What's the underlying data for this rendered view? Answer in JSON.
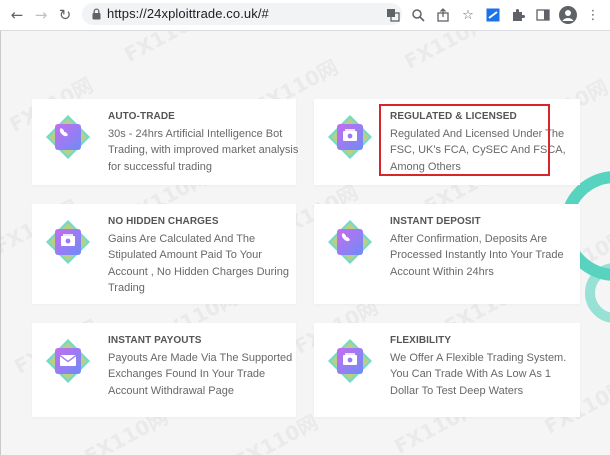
{
  "browser": {
    "url": "https://24xploittrade.co.uk/#"
  },
  "features": [
    {
      "title": "AUTO-TRADE",
      "description": "30s - 24hrs Artificial Intelligence Bot Trading, with improved market analysis for successful trading",
      "icon": "phone-icon"
    },
    {
      "title": "REGULATED & LICENSED",
      "description": "Regulated And Licensed Under The FSC, UK's FCA, CySEC And FSCA, Among Others",
      "icon": "money-icon"
    },
    {
      "title": "NO HIDDEN CHARGES",
      "description": "Gains Are Calculated And The Stipulated Amount Paid To Your Account , No Hidden Charges During Trading",
      "icon": "money-icon"
    },
    {
      "title": "INSTANT DEPOSIT",
      "description": "After Confirmation, Deposits Are Processed Instantly Into Your Trade Account Within 24hrs",
      "icon": "phone-icon"
    },
    {
      "title": "INSTANT PAYOUTS",
      "description": "Payouts Are Made Via The Supported Exchanges Found In Your Trade Account Withdrawal Page",
      "icon": "envelope-icon"
    },
    {
      "title": "FLEXIBILITY",
      "description": "We Offer A Flexible Trading System. You Can Trade With As Low As 1 Dollar To Test Deep Waters",
      "icon": "money-icon"
    }
  ],
  "watermark": "FX110网",
  "colors": {
    "icon_gradient_start": "#c56cf0",
    "icon_gradient_end": "#6e8cf5",
    "icon_diamond_a": "#58d3c0",
    "icon_diamond_b": "#f2c94c",
    "highlight": "#d6252b"
  }
}
